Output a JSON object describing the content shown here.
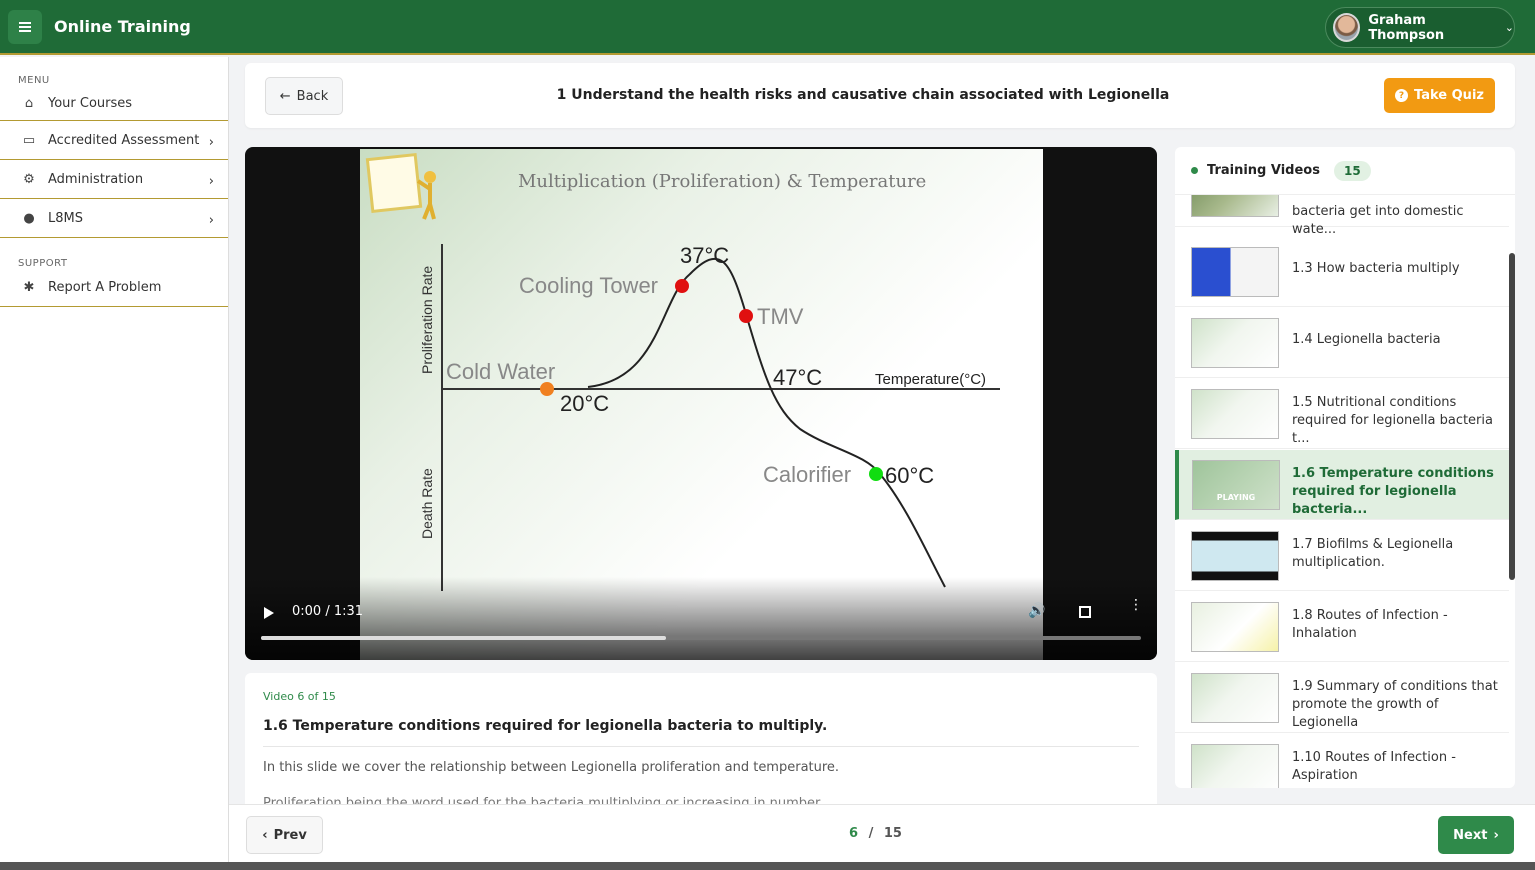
{
  "app": {
    "title": "Online Training"
  },
  "user": {
    "name": "Graham Thompson"
  },
  "sidebar": {
    "menu_label": "MENU",
    "support_label": "SUPPORT",
    "items": [
      {
        "label": "Your Courses",
        "icon": "home-icon"
      },
      {
        "label": "Accredited Assessment",
        "icon": "laptop-icon"
      },
      {
        "label": "Administration",
        "icon": "user-gear-icon"
      },
      {
        "label": "L8MS",
        "icon": "users-icon"
      }
    ],
    "support_items": [
      {
        "label": "Report A Problem",
        "icon": "bug-icon"
      }
    ]
  },
  "header": {
    "back_label": "Back",
    "course_title": "1 Understand the health risks and causative chain associated with Legionella",
    "quiz_label": "Take Quiz"
  },
  "video": {
    "time": "0:00 / 1:31",
    "progress": 0.46,
    "slide": {
      "title": "Multiplication (Proliferation) & Temperature",
      "y_top_label": "Proliferation Rate",
      "y_bottom_label": "Death Rate",
      "x_label": "Temperature(°C)",
      "points": [
        {
          "name": "Cold Water",
          "temp": "20°C",
          "color": "#f08020"
        },
        {
          "name": "Cooling Tower",
          "temp": "37°C",
          "color": "#e01010"
        },
        {
          "name": "TMV",
          "temp": "47°C",
          "color": "#e01010"
        },
        {
          "name": "Calorifier",
          "temp": "60°C",
          "color": "#10dd10"
        }
      ]
    }
  },
  "description": {
    "counter": "Video 6 of 15",
    "title": "1.6 Temperature conditions required for legionella bacteria to multiply.",
    "text": "In this slide we cover the relationship between Legionella proliferation and temperature.",
    "text2": "Proliferation being the word used for the bacteria multiplying or increasing in number."
  },
  "playlist": {
    "title": "Training Videos",
    "count": "15",
    "playing_label": "PLAYING",
    "items": [
      {
        "label": "bacteria get into domestic wate..."
      },
      {
        "label": "1.3 How bacteria multiply"
      },
      {
        "label": "1.4 Legionella bacteria"
      },
      {
        "label": "1.5 Nutritional conditions required for legionella bacteria t..."
      },
      {
        "label": "1.6 Temperature conditions required for legionella bacteria...",
        "active": true
      },
      {
        "label": "1.7 Biofilms & Legionella multiplication."
      },
      {
        "label": "1.8 Routes of Infection - Inhalation"
      },
      {
        "label": "1.9 Summary of conditions that promote the growth of Legionella"
      },
      {
        "label": "1.10 Routes of Infection - Aspiration"
      }
    ]
  },
  "pager": {
    "prev_label": "Prev",
    "next_label": "Next",
    "current": "6",
    "separator": "/",
    "total": "15"
  },
  "colors": {
    "brand": "#1f6b37",
    "accent": "#2f8a4a",
    "quiz": "#f29a12",
    "rule": "#b39a32"
  }
}
